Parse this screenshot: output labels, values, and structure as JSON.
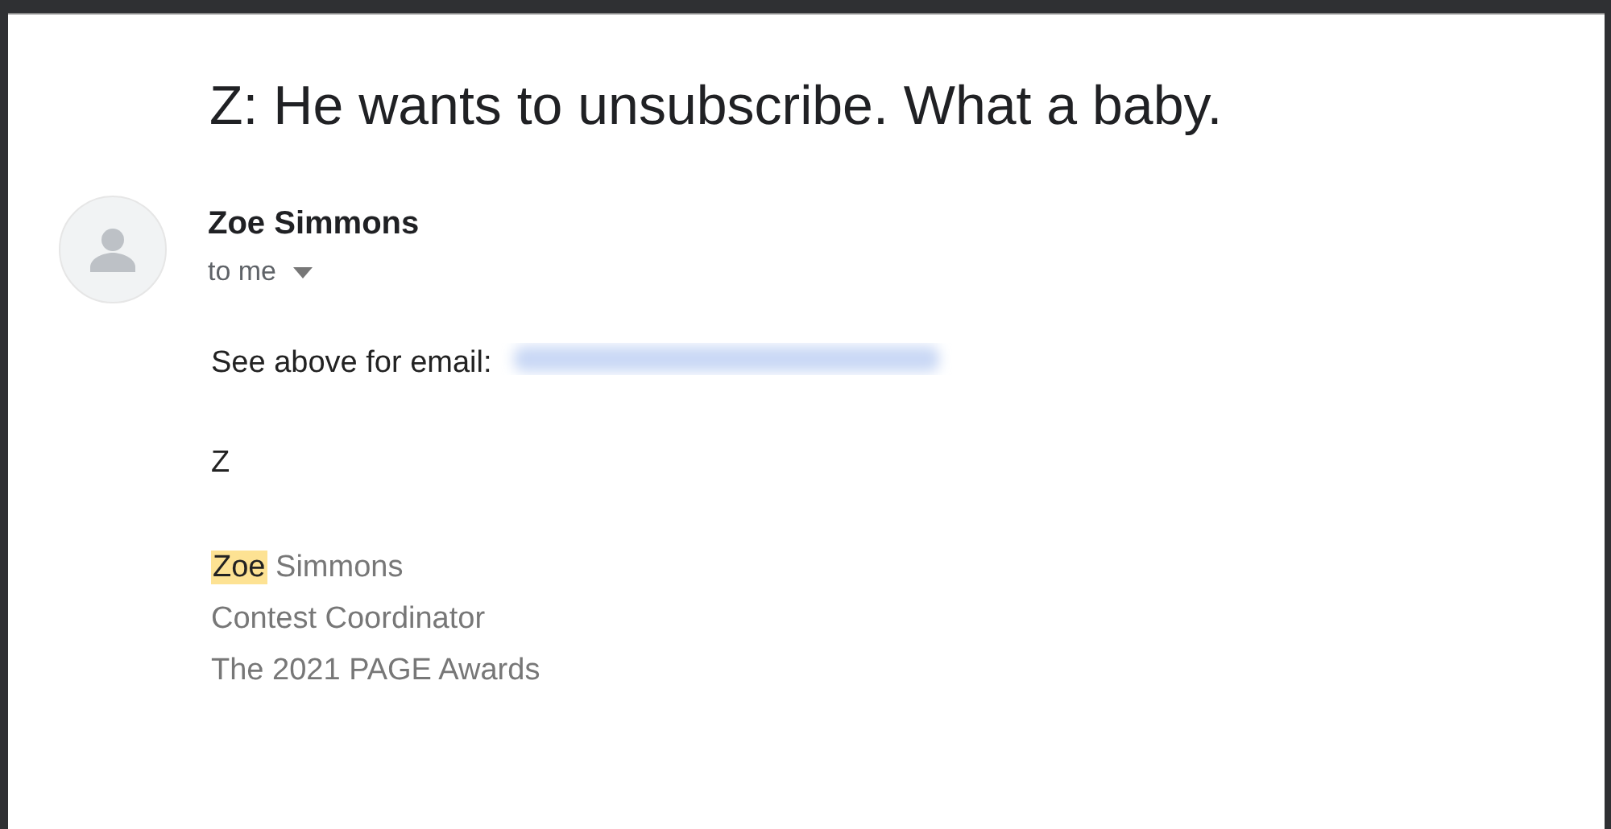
{
  "subject": "Z: He wants to unsubscribe. What a baby.",
  "sender": {
    "name": "Zoe Simmons",
    "recipient": "to me"
  },
  "body": {
    "lead": "See above for email:",
    "email_redacted": true,
    "closing": "Z"
  },
  "signature": {
    "name_parts": [
      {
        "text": "Zoe",
        "highlighted": true
      },
      {
        "text": "Simmons",
        "highlighted": false
      }
    ],
    "lines": [
      "Contest Coordinator",
      "The 2021 PAGE Awards"
    ]
  }
}
